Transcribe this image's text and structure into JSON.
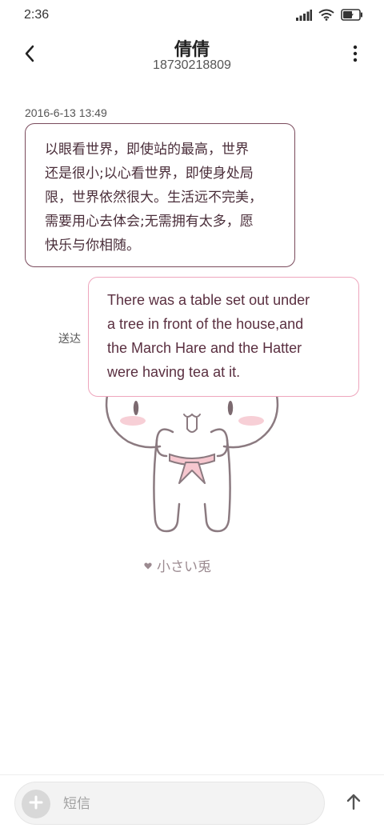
{
  "status_bar": {
    "time": "2:36",
    "icons": [
      "signal-icon",
      "wifi-icon",
      "battery-charging-icon"
    ]
  },
  "header": {
    "contact_name": "倩倩",
    "phone_number": "18730218809",
    "back_icon": "chevron-left-icon",
    "more_icon": "more-vertical-icon"
  },
  "conversation": {
    "timestamp": "2016-6-13 13:49",
    "messages": [
      {
        "direction": "incoming",
        "lines": [
          "以眼看世界，即使站的最高，世界",
          "还是很小;以心看世界，即使身处局",
          "限，世界依然很大。生活远不完美，",
          "需要用心去体会;无需拥有太多，愿",
          "快乐与你相随。"
        ]
      },
      {
        "direction": "outgoing",
        "status": "送达",
        "lines": [
          "There was a table set out under",
          "a tree in front of the house,and",
          "the March Hare and the Hatter",
          "were having tea at it."
        ]
      }
    ]
  },
  "wallpaper": {
    "caption": "小さい兎",
    "caption_icon": "heart-icon"
  },
  "input_bar": {
    "placeholder": "短信",
    "add_icon": "plus-icon",
    "send_icon": "arrow-up-icon"
  },
  "colors": {
    "incoming_border": "#7a4a5c",
    "outgoing_border": "#eea6bd",
    "message_text": "#5a2f40"
  }
}
